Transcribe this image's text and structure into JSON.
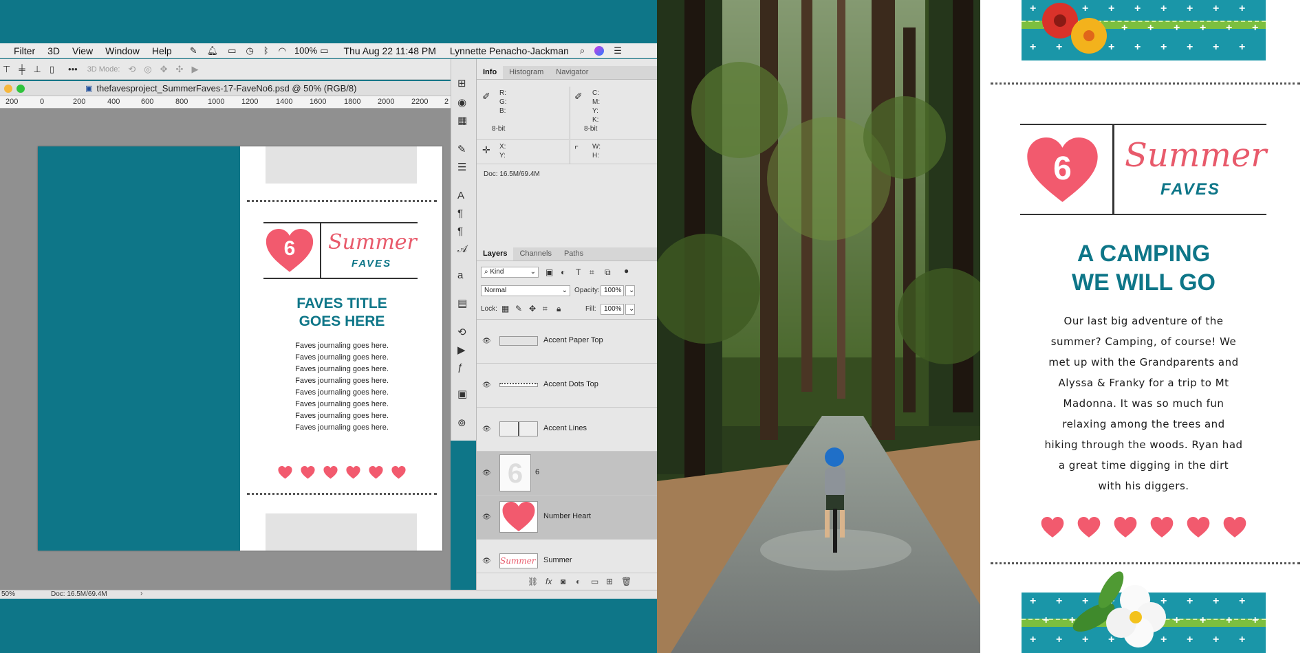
{
  "photoshop": {
    "menu": [
      "Filter",
      "3D",
      "View",
      "Window",
      "Help"
    ],
    "status_right": {
      "battery": "100%",
      "datetime": "Thu Aug 22  11:48 PM",
      "user": "Lynnette Penacho-Jackman"
    },
    "options_bar": {
      "mode_label": "3D Mode:"
    },
    "document_title": "thefavesproject_SummerFaves-17-FaveNo6.psd @ 50% (RGB/8)",
    "ruler_ticks": [
      "200",
      "0",
      "200",
      "400",
      "600",
      "800",
      "1000",
      "1200",
      "1400",
      "1600",
      "1800",
      "2000",
      "2200",
      "2"
    ],
    "status_bar": {
      "zoom": "50%",
      "doc": "Doc: 16.5M/69.4M"
    },
    "canvas": {
      "logo_number": "6",
      "logo_word1": "Summer",
      "logo_word2": "FAVES",
      "title_line1": "FAVES TITLE",
      "title_line2": "GOES HERE",
      "journaling": [
        "Faves journaling goes here.",
        "Faves journaling goes here.",
        "Faves journaling goes here.",
        "Faves journaling goes here.",
        "Faves journaling goes here.",
        "Faves journaling goes here.",
        "Faves journaling goes here.",
        "Faves journaling goes here."
      ],
      "hearts": 6
    },
    "info_panel": {
      "tabs": [
        "Info",
        "Histogram",
        "Navigator"
      ],
      "rgb": [
        "R:",
        "G:",
        "B:"
      ],
      "cmyk": [
        "C:",
        "M:",
        "Y:",
        "K:"
      ],
      "bit_left": "8-bit",
      "bit_right": "8-bit",
      "xy": [
        "X:",
        "Y:"
      ],
      "wh": [
        "W:",
        "H:"
      ],
      "doc": "Doc: 16.5M/69.4M"
    },
    "layers_panel": {
      "tabs": [
        "Layers",
        "Channels",
        "Paths"
      ],
      "filter": "Kind",
      "blend_mode": "Normal",
      "opacity_label": "Opacity:",
      "opacity": "100%",
      "lock_label": "Lock:",
      "fill_label": "Fill:",
      "fill": "100%",
      "layers": [
        {
          "name": "Accent Paper Top",
          "selected": false
        },
        {
          "name": "Accent Dots Top",
          "selected": false
        },
        {
          "name": "Accent Lines",
          "selected": false
        },
        {
          "name": "6",
          "selected": true
        },
        {
          "name": "Number Heart",
          "selected": true
        },
        {
          "name": "Summer",
          "selected": false
        }
      ]
    }
  },
  "layout": {
    "logo_number": "6",
    "logo_word1": "Summer",
    "logo_word2": "FAVES",
    "title_line1": "A CAMPING",
    "title_line2": "WE WILL GO",
    "journaling": [
      "Our last big adventure of the",
      "summer? Camping, of course! We",
      "met up with the Grandparents and",
      "Alyssa & Franky for a trip to Mt",
      "Madonna. It was so much fun",
      "relaxing among the trees and",
      "hiking through the woods. Ryan had",
      "a great time digging in the dirt",
      "with his diggers."
    ],
    "hearts": 6
  },
  "colors": {
    "teal": "#0e7688",
    "coral": "#f25a6e",
    "band_blue": "#1a96a8",
    "ribbon_green": "#7cbf3f"
  }
}
